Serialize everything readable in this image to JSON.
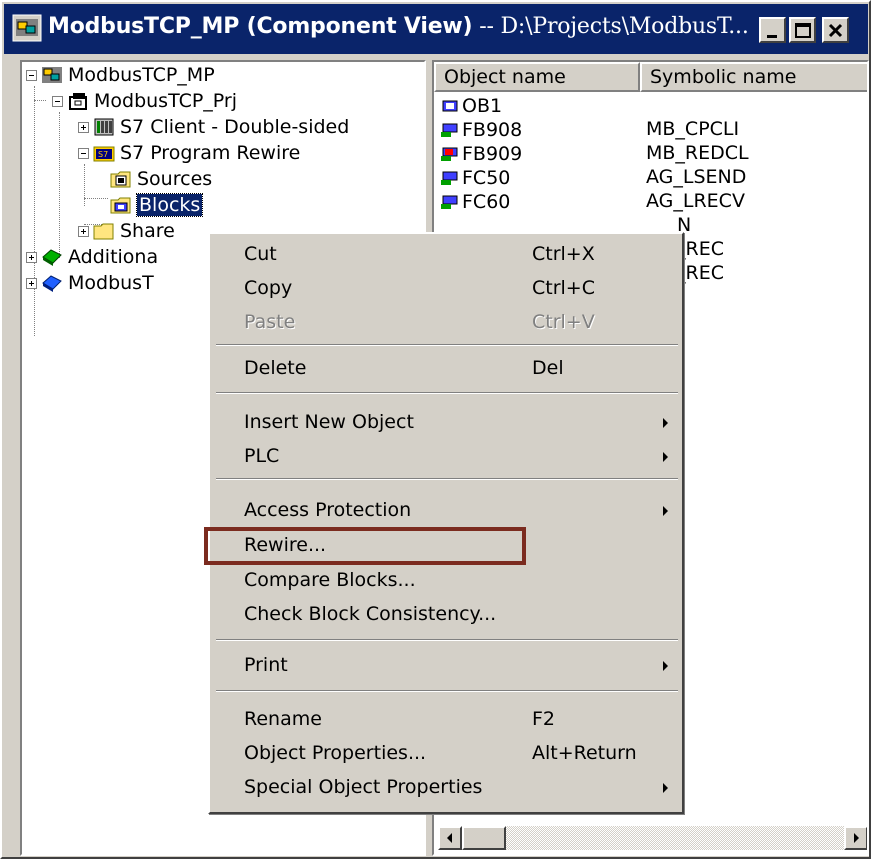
{
  "window": {
    "title_app": "ModbusTCP_MP (Component View)",
    "title_sep": " -- ",
    "title_path": "D:\\Projects\\ModbusT...",
    "controls": [
      "minimize",
      "maximize",
      "close"
    ]
  },
  "tree": {
    "items": [
      {
        "label": "ModbusTCP_MP",
        "icon": "multiproject-icon"
      },
      {
        "label": "ModbusTCP_Prj",
        "icon": "project-icon"
      },
      {
        "label": "S7 Client - Double-sided",
        "icon": "station-icon"
      },
      {
        "label": "S7 Program Rewire",
        "icon": "s7-program-icon"
      },
      {
        "label": "Sources",
        "icon": "sources-folder-icon"
      },
      {
        "label": "Blocks",
        "icon": "blocks-folder-icon",
        "selected": true
      },
      {
        "label": "Share",
        "icon": "folder-icon"
      },
      {
        "label": "Additiona",
        "icon": "library-icon"
      },
      {
        "label": "ModbusT",
        "icon": "library-blue-icon"
      }
    ]
  },
  "list": {
    "columns": [
      "Object name",
      "Symbolic name"
    ],
    "rows": [
      {
        "name": "OB1",
        "symbol": "",
        "icon": "ob-icon"
      },
      {
        "name": "FB908",
        "symbol": "MB_CPCLI",
        "icon": "fb-icon"
      },
      {
        "name": "FB909",
        "symbol": "MB_REDCL",
        "icon": "fb-protected-icon"
      },
      {
        "name": "FC50",
        "symbol": "AG_LSEND",
        "icon": "fc-icon"
      },
      {
        "name": "FC60",
        "symbol": "AG_LRECV",
        "icon": "fc-icon"
      },
      {
        "name": "",
        "symbol": "N",
        "icon": ""
      },
      {
        "name": "",
        "symbol": "_REC",
        "icon": ""
      },
      {
        "name": "",
        "symbol": "_REC",
        "icon": ""
      }
    ]
  },
  "context_menu": {
    "items": [
      {
        "label": "Cut",
        "shortcut": "Ctrl+X",
        "enabled": true
      },
      {
        "label": "Copy",
        "shortcut": "Ctrl+C",
        "enabled": true
      },
      {
        "label": "Paste",
        "shortcut": "Ctrl+V",
        "enabled": false
      },
      {
        "label": "Delete",
        "shortcut": "Del",
        "enabled": true
      },
      {
        "label": "Insert New Object",
        "shortcut": "",
        "submenu": true
      },
      {
        "label": "PLC",
        "shortcut": "",
        "submenu": true
      },
      {
        "label": "Access Protection",
        "shortcut": "",
        "submenu": true
      },
      {
        "label": "Rewire...",
        "shortcut": "",
        "highlighted_box": true
      },
      {
        "label": "Compare Blocks...",
        "shortcut": ""
      },
      {
        "label": "Check Block Consistency...",
        "shortcut": ""
      },
      {
        "label": "Print",
        "shortcut": "",
        "submenu": true
      },
      {
        "label": "Rename",
        "shortcut": "F2"
      },
      {
        "label": "Object Properties...",
        "shortcut": "Alt+Return"
      },
      {
        "label": "Special Object Properties",
        "shortcut": "",
        "submenu": true
      }
    ]
  },
  "colors": {
    "titlebar": "#0a246a",
    "face": "#d4d0c8",
    "selection": "#0a246a",
    "annotation_box": "#7b2b1f"
  }
}
